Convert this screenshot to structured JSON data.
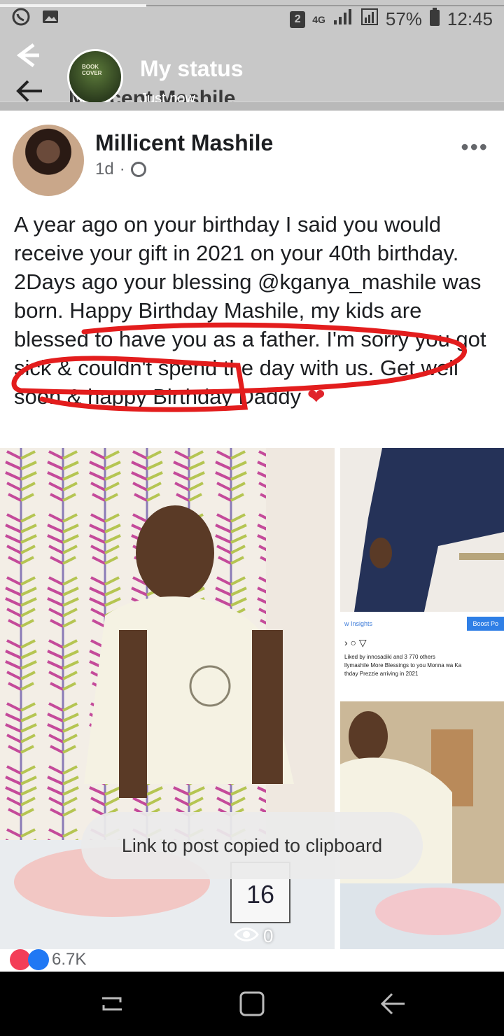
{
  "status_bar": {
    "battery": "57%",
    "time": "12:45",
    "network": "4G",
    "sim_slot": "2",
    "story_progress": 0.29
  },
  "story_header": {
    "title": "My status",
    "timestamp": "Just now",
    "underlying_name": "Millicent Mashile"
  },
  "post": {
    "author": "Millicent Mashile",
    "age": "1d",
    "separator": "·",
    "text": "A year ago on your birthday I said you would receive your gift in 2021 on your 40th birthday. 2Days ago your blessing @kganya_mashile was born. Happy Birthday Mashile, my kids are blessed to have you as a father. I'm sorry you got sick & couldn't spend the day with us. Get well soon & happy Birthday Daddy",
    "heart": "❤",
    "reaction_count": "6.7K"
  },
  "embedded_ig": {
    "insights": "w Insights",
    "boost": "Boost Po",
    "liked_by": "Liked by innosadiki and 3 770 others",
    "caption": "llymashile More Blessings to you Monna wa Ka",
    "caption2": "thday Prezzie arriving in 2021"
  },
  "crib_number": "16",
  "toast": "Link to post copied to clipboard",
  "views": "0"
}
